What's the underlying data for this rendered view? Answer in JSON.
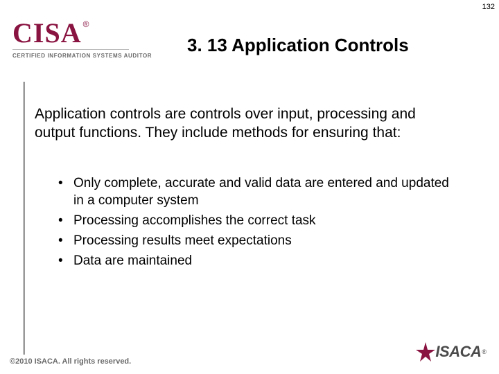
{
  "page_number": "132",
  "logo": {
    "text": "CISA",
    "reg": "®",
    "subtitle": "CERTIFIED INFORMATION SYSTEMS AUDITOR"
  },
  "title": "3. 13 Application Controls",
  "body_text": "Application controls are controls over input, processing and output functions. They include methods for ensuring that:",
  "bullets": [
    "Only complete, accurate and valid data are entered and updated in a computer system",
    "Processing accomplishes the correct task",
    "Processing results meet expectations",
    "Data are maintained"
  ],
  "footer": {
    "copyright": "©2010 ISACA.  All rights reserved.",
    "org": "ISACA",
    "org_reg": "®"
  }
}
